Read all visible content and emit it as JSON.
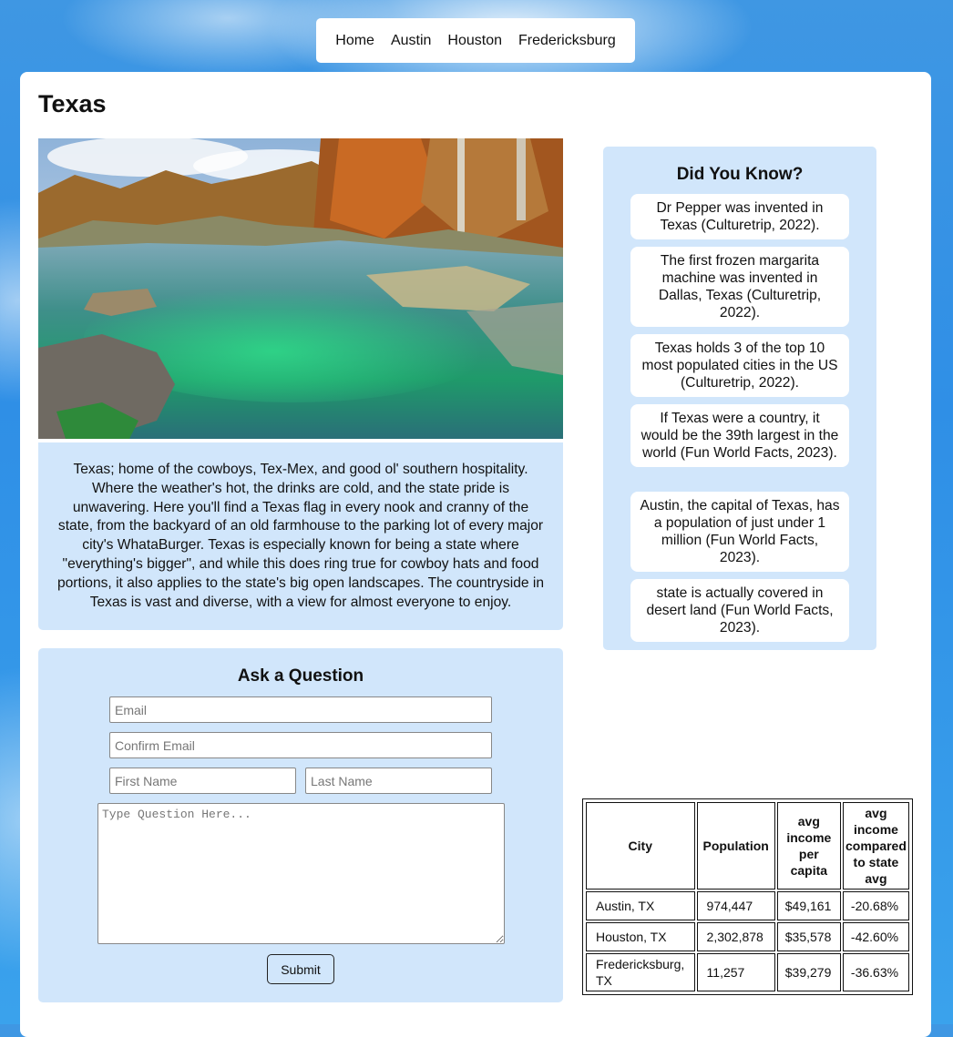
{
  "nav": {
    "items": [
      {
        "label": "Home"
      },
      {
        "label": "Austin"
      },
      {
        "label": "Houston"
      },
      {
        "label": "Fredericksburg"
      }
    ]
  },
  "page_title": "Texas",
  "description": "Texas; home of the cowboys, Tex-Mex, and good ol' southern hospitality. Where the weather's hot, the drinks are cold, and the state pride is unwavering. Here you'll find a Texas flag in every nook and cranny of the state, from the backyard of an old farmhouse to the parking lot of every major city's WhataBurger. Texas is especially known for being a state where \"everything's bigger\", and while this does ring true for cowboy hats and food portions, it also applies to the state's big open landscapes. The countryside in Texas is vast and diverse, with a view for almost everyone to enjoy.",
  "form": {
    "title": "Ask a Question",
    "email_placeholder": "Email",
    "confirm_email_placeholder": "Confirm Email",
    "first_name_placeholder": "First Name",
    "last_name_placeholder": "Last Name",
    "question_placeholder": "Type Question Here...",
    "submit_label": "Submit"
  },
  "facts": {
    "title": "Did You Know?",
    "items": [
      {
        "text": "Dr Pepper was invented in Texas (Culturetrip, 2022)."
      },
      {
        "text": "The first frozen margarita machine was invented in Dallas, Texas (Culturetrip, 2022)."
      },
      {
        "text": "Texas holds 3 of the top 10 most populated cities in the US (Culturetrip, 2022)."
      },
      {
        "text": "If Texas were a country, it would be the 39th largest in the world (Fun World Facts, 2023)."
      },
      {
        "text": "Austin, the capital of Texas, has a population of just under 1 million (Fun World Facts, 2023)."
      },
      {
        "text": "state is actually covered in desert land (Fun World Facts, 2023)."
      }
    ]
  },
  "table": {
    "headers": [
      "City",
      "Population",
      "avg income per capita",
      "avg income compared to state avg"
    ],
    "rows": [
      [
        "Austin, TX",
        "974,447",
        "$49,161",
        "-20.68%"
      ],
      [
        "Houston, TX",
        "2,302,878",
        "$35,578",
        "-42.60%"
      ],
      [
        "Fredericksburg, TX",
        "11,257",
        "$39,279",
        "-36.63%"
      ]
    ]
  }
}
